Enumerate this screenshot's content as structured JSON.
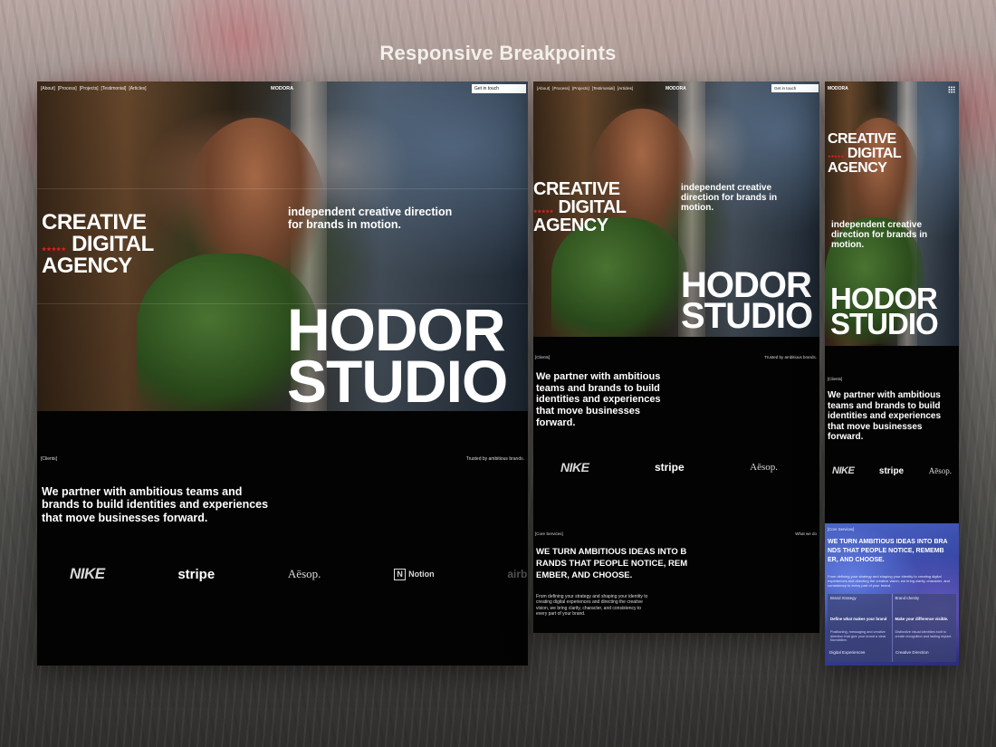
{
  "page": {
    "heading": "Responsive Breakpoints"
  },
  "nav": {
    "items": [
      "[About]",
      "[Process]",
      "[Projects]",
      "[Testimonial]",
      "[Articles]"
    ],
    "logo": "MODORA",
    "cta": "Get in touch"
  },
  "hero": {
    "agency_line1": "CREATIVE",
    "agency_line2": "DIGITAL",
    "agency_line3": "AGENCY",
    "stars": "★★★★★",
    "tagline": "independent creative direction for brands in motion.",
    "brand_line1": "HODOR",
    "brand_line2": "STUDIO"
  },
  "clients": {
    "label": "[Clients]",
    "trusted": "Trusted by ambitious brands.",
    "text": "We partner with ambitious teams and brands to build identities and experiences that move businesses forward.",
    "logos": [
      "NIKE",
      "stripe",
      "Aēsop.",
      "Notion",
      "airbnb"
    ]
  },
  "services": {
    "label": "[Core Services]",
    "what": "What we do",
    "headline_tablet": [
      "WE TURN AMBITIOUS IDEAS INTO B",
      "RANDS THAT PEOPLE NOTICE, REM",
      "EMBER, AND CHOOSE."
    ],
    "headline_mobile": [
      "WE TURN AMBITIOUS IDEAS INTO BRA",
      "NDS THAT PEOPLE NOTICE, REMEMB",
      "ER, AND CHOOSE."
    ],
    "description": "From defining your strategy and shaping your identity to creating digital experiences and directing the creative vision, we bring clarity, character, and consistency to every part of your brand.",
    "cards": [
      {
        "label": "Brand Strategy",
        "title": "Define what makes your brand",
        "desc": "Positioning, messaging and creative direction that give your brand a clear foundation."
      },
      {
        "label": "Brand Identity",
        "title": "Make your difference visible.",
        "desc": "Distinctive visual identities built to create recognition and lasting impact."
      }
    ],
    "footer": [
      "Digital Experiences",
      "Creative Direction"
    ]
  }
}
